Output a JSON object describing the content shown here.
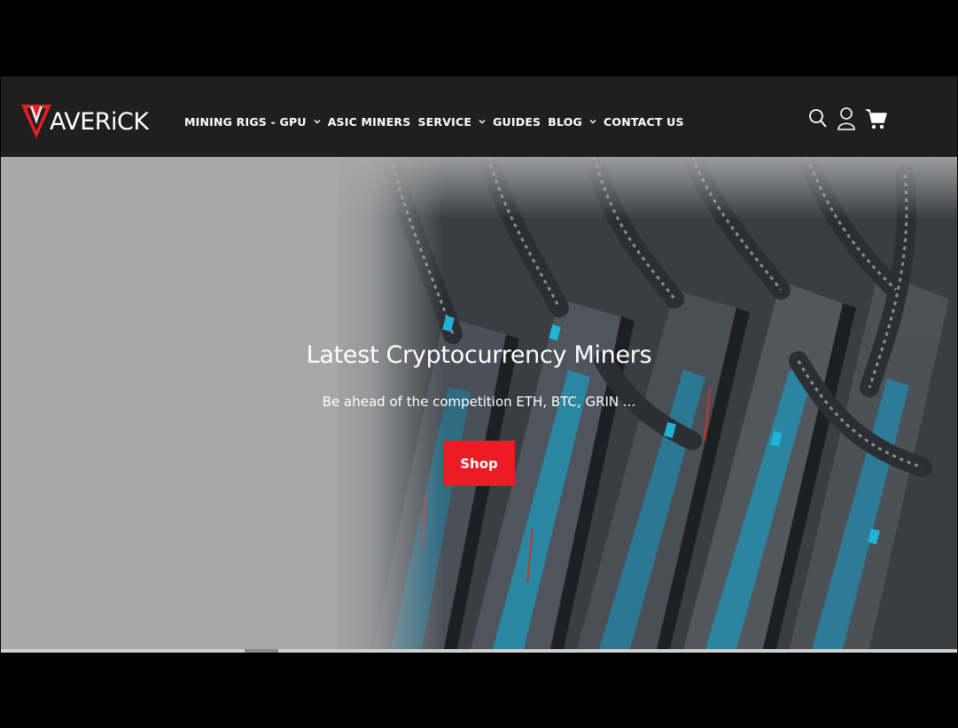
{
  "brand": {
    "logo_text": "AVERiCK",
    "accent_color": "#ed1c24"
  },
  "nav": {
    "items": [
      {
        "label": "MINING RIGS - GPU",
        "has_dropdown": true
      },
      {
        "label": "ASIC MINERS",
        "has_dropdown": false
      },
      {
        "label": "SERVICE",
        "has_dropdown": true
      },
      {
        "label": "GUIDES",
        "has_dropdown": false
      },
      {
        "label": "BLOG",
        "has_dropdown": true
      },
      {
        "label": "CONTACT US",
        "has_dropdown": false
      }
    ]
  },
  "header_icons": [
    "search-icon",
    "account-icon",
    "cart-icon"
  ],
  "hero": {
    "title": "Latest Cryptocurrency Miners",
    "subtitle": "Be ahead of the competition ETH, BTC, GRIN ...",
    "cta_label": "Shop"
  }
}
